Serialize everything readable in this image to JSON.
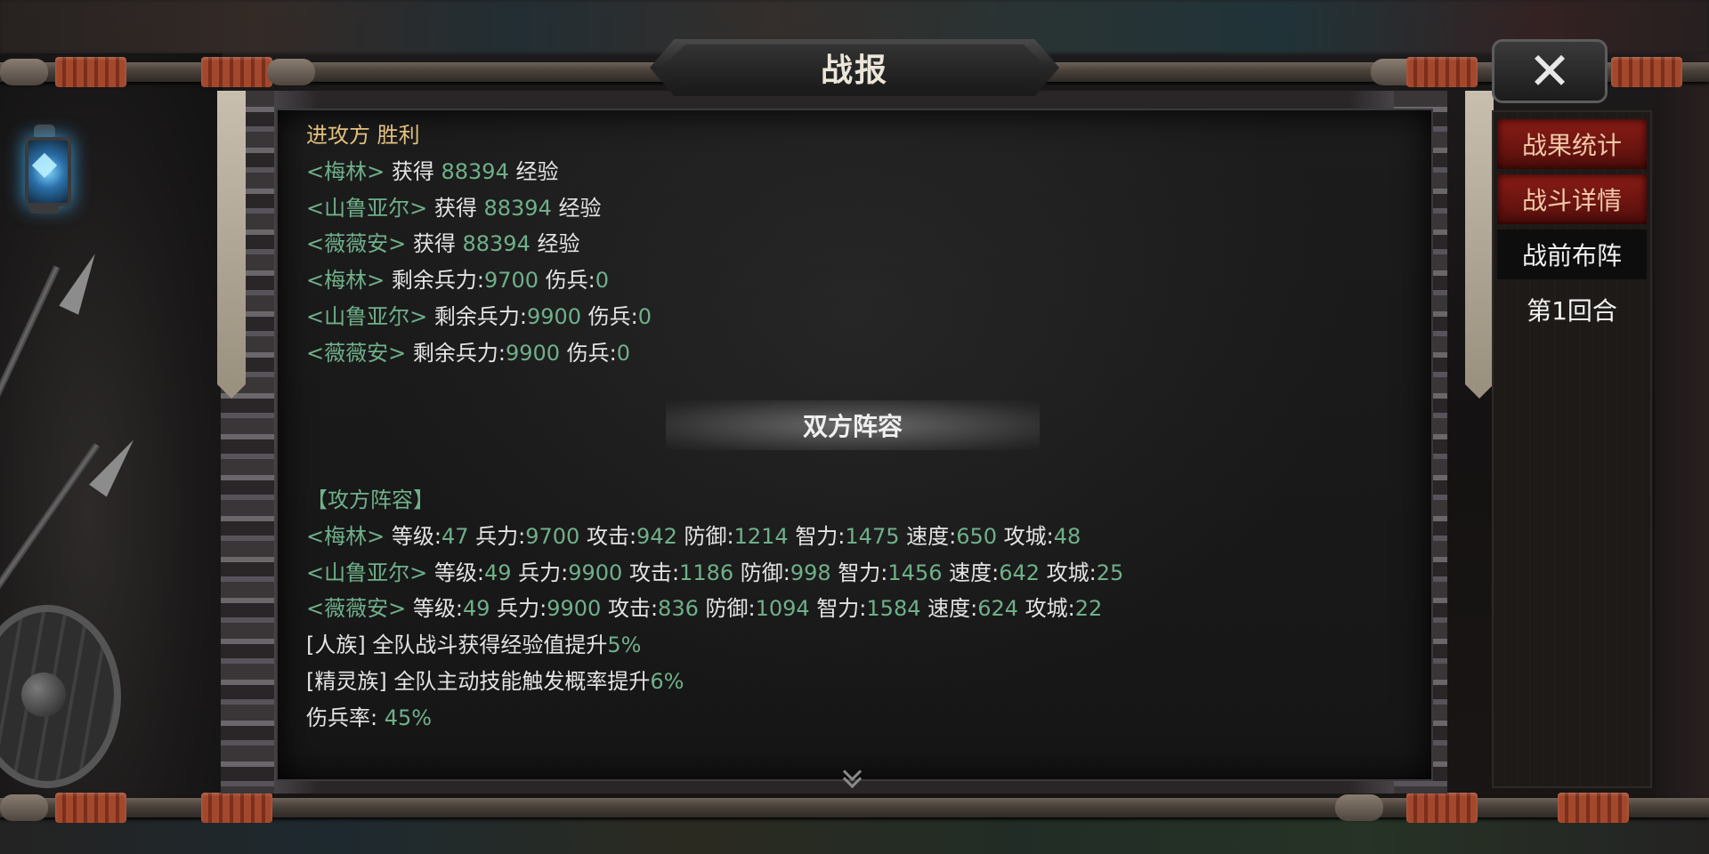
{
  "window": {
    "title": "战报"
  },
  "close": {
    "label": "✕"
  },
  "tabs": [
    "战果统计",
    "战斗详情",
    "战前布阵",
    "第1回合"
  ],
  "result": {
    "side": "进攻方",
    "outcome": "胜利"
  },
  "exp_lines": [
    {
      "name": "<梅林>",
      "verb": "获得",
      "amount": "88394",
      "unit": "经验"
    },
    {
      "name": "<山鲁亚尔>",
      "verb": "获得",
      "amount": "88394",
      "unit": "经验"
    },
    {
      "name": "<薇薇安>",
      "verb": "获得",
      "amount": "88394",
      "unit": "经验"
    }
  ],
  "troop_lines": [
    {
      "name": "<梅林>",
      "remain_label": "剩余兵力:",
      "remain": "9700",
      "wound_label": "伤兵:",
      "wound": "0"
    },
    {
      "name": "<山鲁亚尔>",
      "remain_label": "剩余兵力:",
      "remain": "9900",
      "wound_label": "伤兵:",
      "wound": "0"
    },
    {
      "name": "<薇薇安>",
      "remain_label": "剩余兵力:",
      "remain": "9900",
      "wound_label": "伤兵:",
      "wound": "0"
    }
  ],
  "section_title": "双方阵容",
  "attack_header": "【攻方阵容】",
  "lineup": [
    {
      "name": "<梅林>",
      "lv_label": "等级:",
      "lv": "47",
      "troop_label": "兵力:",
      "troop": "9700",
      "atk_label": "攻击:",
      "atk": "942",
      "def_label": "防御:",
      "def": "1214",
      "int_label": "智力:",
      "int": "1475",
      "spd_label": "速度:",
      "spd": "650",
      "siege_label": "攻城:",
      "siege": "48"
    },
    {
      "name": "<山鲁亚尔>",
      "lv_label": "等级:",
      "lv": "49",
      "troop_label": "兵力:",
      "troop": "9900",
      "atk_label": "攻击:",
      "atk": "1186",
      "def_label": "防御:",
      "def": "998",
      "int_label": "智力:",
      "int": "1456",
      "spd_label": "速度:",
      "spd": "642",
      "siege_label": "攻城:",
      "siege": "25"
    },
    {
      "name": "<薇薇安>",
      "lv_label": "等级:",
      "lv": "49",
      "troop_label": "兵力:",
      "troop": "9900",
      "atk_label": "攻击:",
      "atk": "836",
      "def_label": "防御:",
      "def": "1094",
      "int_label": "智力:",
      "int": "1584",
      "spd_label": "速度:",
      "spd": "624",
      "siege_label": "攻城:",
      "siege": "22"
    }
  ],
  "buffs": [
    {
      "text": "[人族] 全队战斗获得经验值提升",
      "value": "5%"
    },
    {
      "text": "[精灵族] 全队主动技能触发概率提升",
      "value": "6%"
    }
  ],
  "casualty": {
    "label": "伤兵率: ",
    "value": "45%"
  },
  "colors": {
    "gold": "#e2c07c",
    "green": "#6fb08a",
    "text": "#e4e4e4",
    "tab_active": "#8a1c16"
  }
}
